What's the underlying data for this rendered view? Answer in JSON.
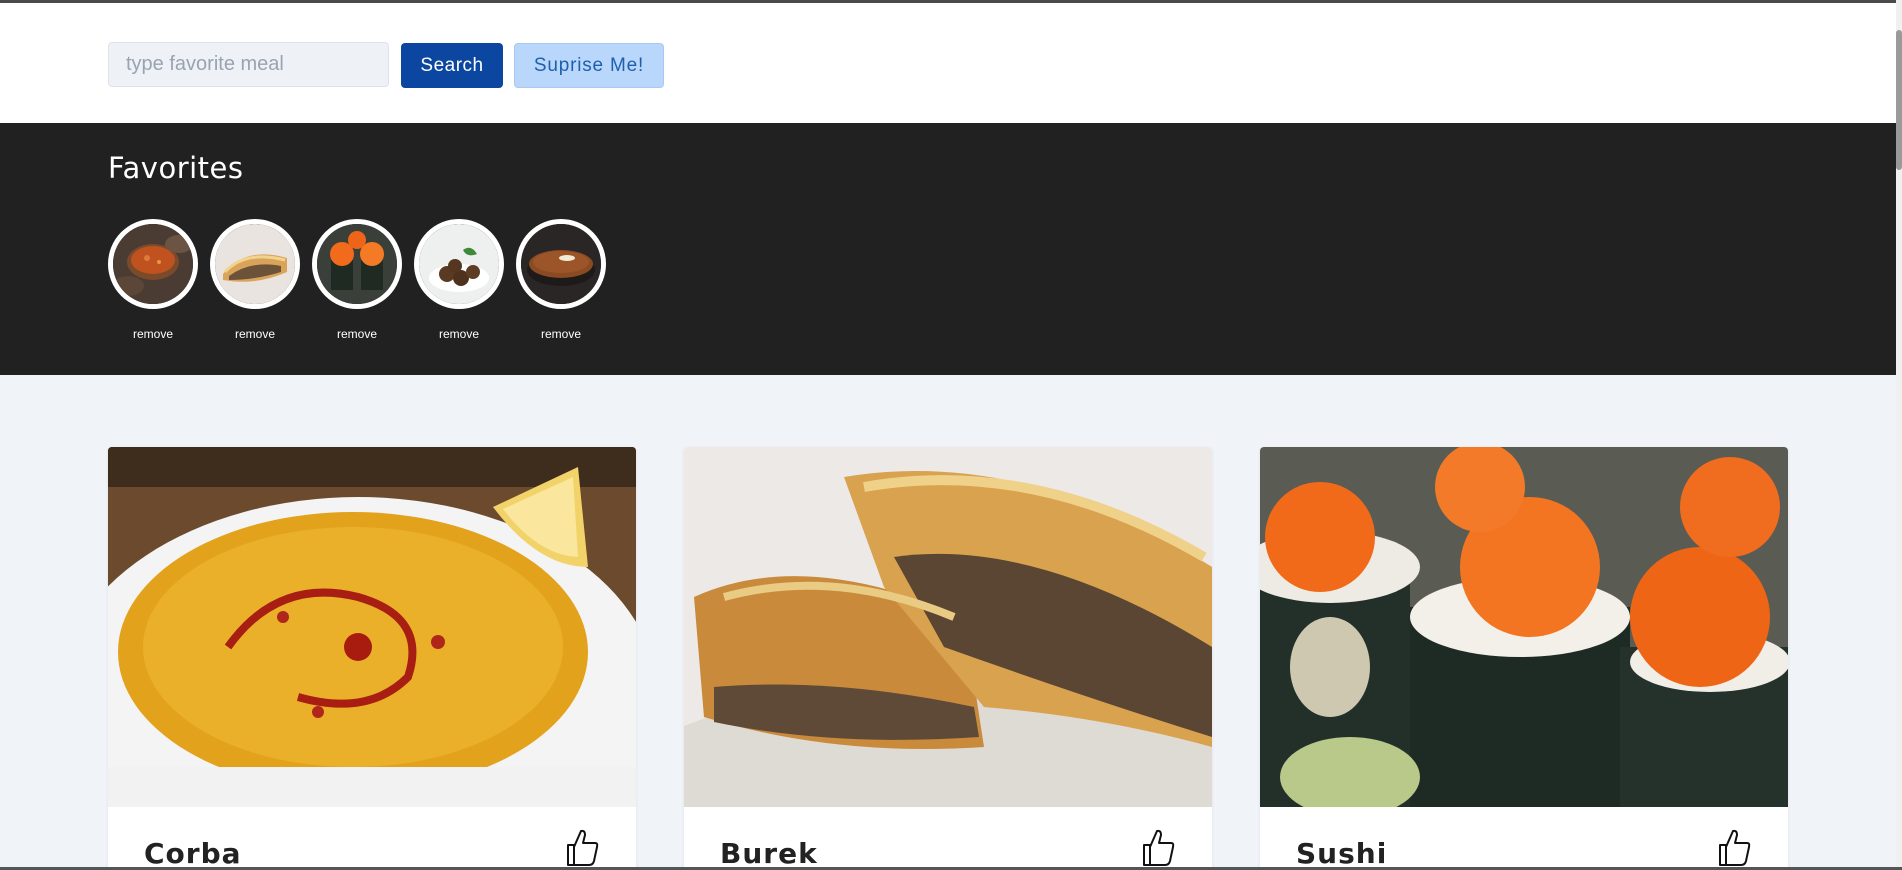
{
  "search": {
    "placeholder": "type favorite meal",
    "value": "",
    "search_label": "Search",
    "surprise_label": "Suprise Me!"
  },
  "favorites": {
    "title": "Favorites",
    "items": [
      {
        "image": "soup-bowls-image",
        "remove_label": "remove"
      },
      {
        "image": "pastry-image",
        "remove_label": "remove"
      },
      {
        "image": "sushi-image",
        "remove_label": "remove"
      },
      {
        "image": "meatballs-image",
        "remove_label": "remove"
      },
      {
        "image": "pie-image",
        "remove_label": "remove"
      }
    ]
  },
  "meals": [
    {
      "name": "Corba",
      "image": "lentil-soup-image",
      "like_icon": "thumbs-up-icon"
    },
    {
      "name": "Burek",
      "image": "burek-pastry-image",
      "like_icon": "thumbs-up-icon"
    },
    {
      "name": "Sushi",
      "image": "sushi-rolls-image",
      "like_icon": "thumbs-up-icon"
    }
  ],
  "colors": {
    "search_button": "#0b47a1",
    "surprise_button": "#b9d7fb",
    "favorites_bg": "#212121",
    "page_bg": "#f0f3f8"
  }
}
